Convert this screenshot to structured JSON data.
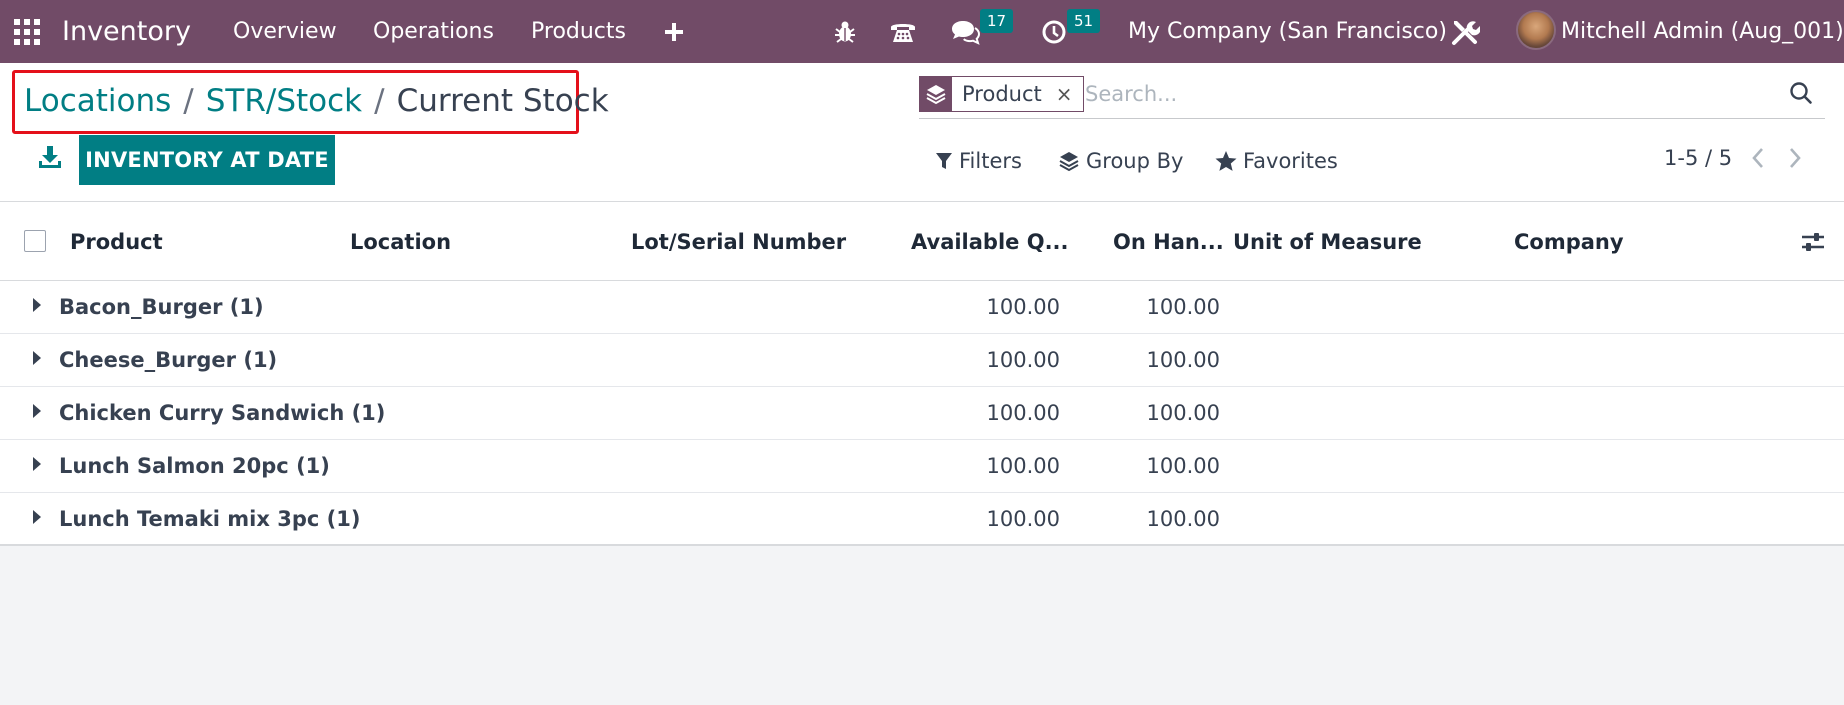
{
  "navbar": {
    "app_name": "Inventory",
    "menu": [
      "Overview",
      "Operations",
      "Products"
    ],
    "messages_count": "17",
    "activities_count": "51",
    "company": "My Company (San Francisco)",
    "user": "Mitchell Admin (Aug_001)"
  },
  "breadcrumb": {
    "items": [
      "Locations",
      "STR/Stock"
    ],
    "current": "Current Stock",
    "separator": "/"
  },
  "actions": {
    "primary_label": "INVENTORY AT DATE"
  },
  "search": {
    "facet_label": "Product",
    "facet_remove": "×",
    "placeholder": "Search..."
  },
  "filters": {
    "filters_label": "Filters",
    "groupby_label": "Group By",
    "favorites_label": "Favorites"
  },
  "pager": {
    "value": "1-5 / 5"
  },
  "table": {
    "columns": [
      "Product",
      "Location",
      "Lot/Serial Number",
      "Available Q...",
      "On Han...",
      "Unit of Measure",
      "Company"
    ],
    "rows": [
      {
        "name": "Bacon_Burger (1)",
        "available": "100.00",
        "on_hand": "100.00"
      },
      {
        "name": "Cheese_Burger (1)",
        "available": "100.00",
        "on_hand": "100.00"
      },
      {
        "name": "Chicken Curry Sandwich (1)",
        "available": "100.00",
        "on_hand": "100.00"
      },
      {
        "name": "Lunch Salmon 20pc (1)",
        "available": "100.00",
        "on_hand": "100.00"
      },
      {
        "name": "Lunch Temaki mix 3pc (1)",
        "available": "100.00",
        "on_hand": "100.00"
      }
    ]
  },
  "colors": {
    "navbar": "#714B67",
    "accent": "#017E84",
    "highlight_box": "#e4101a"
  }
}
